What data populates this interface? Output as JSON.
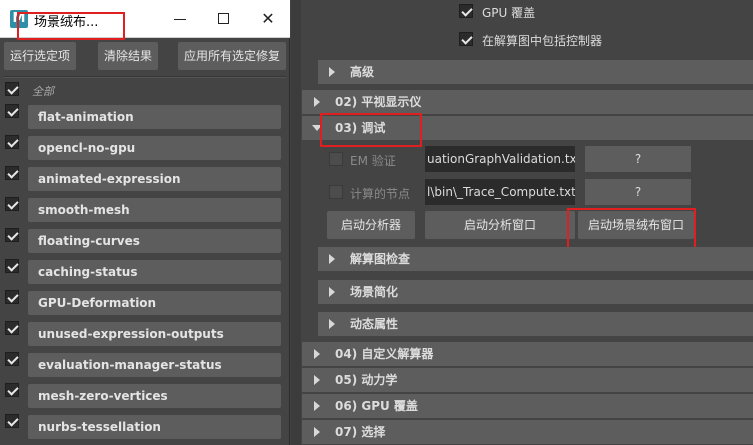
{
  "window": {
    "title": "场景绒布...",
    "icon_letter": "M",
    "minimize_icon": "minimize-icon",
    "maximize_icon": "maximize-icon",
    "close_glyph": "✕"
  },
  "toolbar": {
    "run_selected": "运行选定项",
    "clear_results": "清除结果",
    "apply_fixes": "应用所有选定修复"
  },
  "tests": {
    "all_label": "全部",
    "items": [
      "flat-animation",
      "opencl-no-gpu",
      "animated-expression",
      "smooth-mesh",
      "floating-curves",
      "caching-status",
      "GPU-Deformation",
      "unused-expression-outputs",
      "evaluation-manager-status",
      "mesh-zero-vertices",
      "nurbs-tessellation"
    ]
  },
  "options": {
    "gpu_override": "GPU 覆盖",
    "include_controllers": "在解算图中包括控制器"
  },
  "sections": {
    "advanced": "高级",
    "heads_up": "02) 平视显示仪",
    "debug": "03) 调试",
    "solver_check": "解算图检查",
    "scene_simplify": "场景简化",
    "dynamic_attrs": "动态属性",
    "custom_evaluator": "04) 自定义解算器",
    "dynamics": "05) 动力学",
    "gpu_override": "06) GPU 覆盖",
    "selection": "07) 选择"
  },
  "debug": {
    "em_validation_label": "EM 验证",
    "em_validation_file": "uationGraphValidation.txt",
    "computed_nodes_label": "计算的节点",
    "computed_nodes_file": "l\\bin\\_Trace_Compute.txt",
    "help_label": "?",
    "launch_profiler": "启动分析器",
    "launch_profiler_window": "启动分析窗口",
    "launch_scene_lint_window": "启动场景绒布窗口"
  },
  "colors": {
    "highlight": "#e02020"
  }
}
